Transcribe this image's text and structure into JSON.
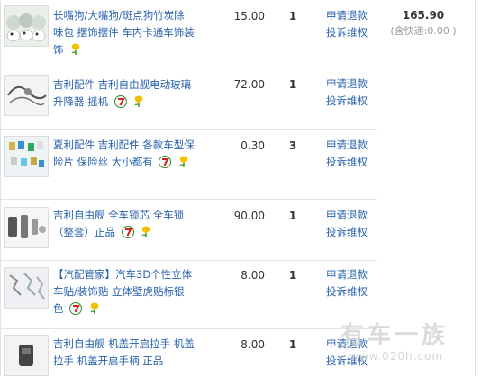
{
  "order": {
    "total": "165.90",
    "shipping_note": "(含快递:0.00 )",
    "items": [
      {
        "title": "长嘴狗/大嘴狗/斑点狗竹炭除味包 摆饰摆件 车内卡通车饰装饰",
        "price": "15.00",
        "qty": "1",
        "refund": "申请退款",
        "complaint": "投诉维权"
      },
      {
        "title": "吉利配件 吉利自由舰电动玻璃升降器 摇机",
        "price": "72.00",
        "qty": "1",
        "refund": "申请退款",
        "complaint": "投诉维权"
      },
      {
        "title": "夏利配件 吉利配件 各款车型保险片 保险丝 大小都有",
        "price": "0.30",
        "qty": "3",
        "refund": "申请退款",
        "complaint": "投诉维权"
      },
      {
        "title": "吉利自由舰 全车锁芯 全车锁（整套）正品",
        "price": "90.00",
        "qty": "1",
        "refund": "申请退款",
        "complaint": "投诉维权"
      },
      {
        "title": "【汽配管家】汽车3D个性立体车贴/装饰贴 立体壁虎贴标银色",
        "price": "8.00",
        "qty": "1",
        "refund": "申请退款",
        "complaint": "投诉维权"
      },
      {
        "title": "吉利自由舰 机盖开启拉手 机盖拉手 机盖开启手柄 正品",
        "price": "8.00",
        "qty": "1",
        "refund": "申请退款",
        "complaint": "投诉维权"
      }
    ]
  },
  "watermark": {
    "text": "有车一族",
    "url": "www.020h.com"
  },
  "colors": {
    "link": "#2a63ad",
    "border": "#e3e3e3"
  }
}
